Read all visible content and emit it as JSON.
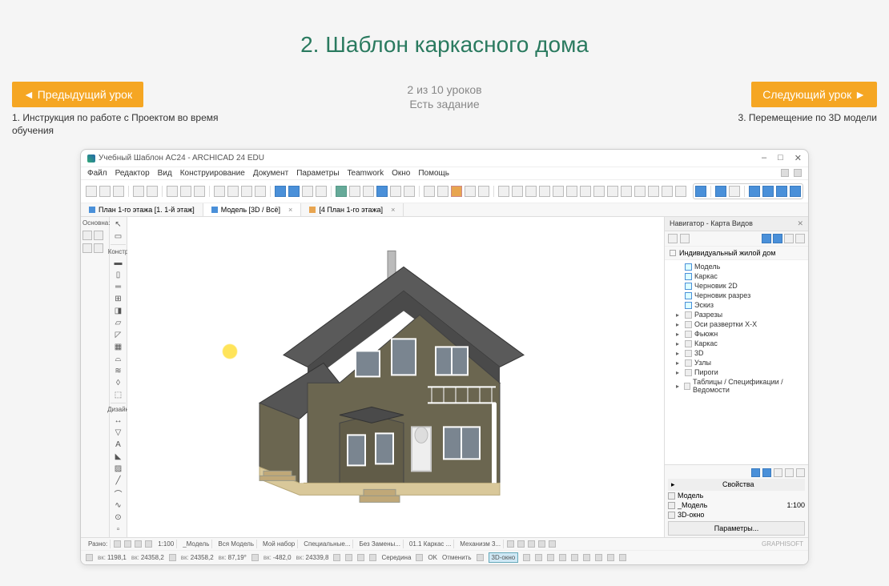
{
  "page": {
    "title": "2. Шаблон каркасного дома",
    "progress": "2 из 10 уроков",
    "has_task": "Есть задание"
  },
  "nav": {
    "prev_btn": "◄  Предыдущий урок",
    "prev_desc": "1. Инструкция по работе с Проектом во время обучения",
    "next_btn": "Следующий урок  ►",
    "next_desc": "3. Перемещение по 3D модели"
  },
  "app": {
    "title": "Учебный Шаблон AC24 - ARCHICAD 24 EDU",
    "menus": [
      "Файл",
      "Редактор",
      "Вид",
      "Конструирование",
      "Документ",
      "Параметры",
      "Teamwork",
      "Окно",
      "Помощь"
    ],
    "left_panel": {
      "label_top": "Основна:",
      "label_constr": "Констр",
      "label_design": "Дизайн"
    },
    "tabs": [
      {
        "label": "План 1-го этажа [1. 1-й этаж]",
        "icon": "blue"
      },
      {
        "label": "Модель [3D / Всё]",
        "icon": "blue",
        "close": true
      },
      {
        "label": "[4 План 1-го этажа]",
        "icon": "orange",
        "close": true
      }
    ],
    "navigator": {
      "title": "Навигатор - Карта Видов",
      "root": "Индивидуальный жилой дом",
      "items": [
        {
          "label": "Модель",
          "type": "view"
        },
        {
          "label": "Каркас",
          "type": "view"
        },
        {
          "label": "Черновик 2D",
          "type": "view"
        },
        {
          "label": "Черновик разрез",
          "type": "view"
        },
        {
          "label": "Эскиз",
          "type": "view"
        },
        {
          "label": "Разрезы",
          "type": "folder"
        },
        {
          "label": "Оси развертки X-X",
          "type": "folder"
        },
        {
          "label": "Фьюжн",
          "type": "folder"
        },
        {
          "label": "Каркас",
          "type": "folder"
        },
        {
          "label": "3D",
          "type": "folder"
        },
        {
          "label": "Узлы",
          "type": "folder"
        },
        {
          "label": "Пироги",
          "type": "folder"
        },
        {
          "label": "Таблицы / Спецификации / Ведомости",
          "type": "folder"
        }
      ],
      "props_header": "Свойства",
      "props_model": "Модель",
      "props_sub1": "_Модель",
      "props_scale": "1:100",
      "props_sub2": "3D-окно",
      "btn": "Параметры..."
    },
    "status": {
      "razno": "Разно:",
      "scale": "1:100",
      "items": [
        "_Модель",
        "Вся Модель",
        "Мой набор",
        "Специальные...",
        "Без Замены...",
        "01.1  Каркас ...",
        "Механизм 3..."
      ],
      "ok": "OK",
      "otmena": "Отменить",
      "middle": "Середина",
      "active": "3D-окно",
      "brand": "GRAPHISOFT"
    },
    "status2": {
      "r": "1198,1",
      "a": "24358,2",
      "x": "24358,2",
      "y": "87,19°",
      "dx": "-482,0",
      "dy": "24339,8"
    }
  }
}
